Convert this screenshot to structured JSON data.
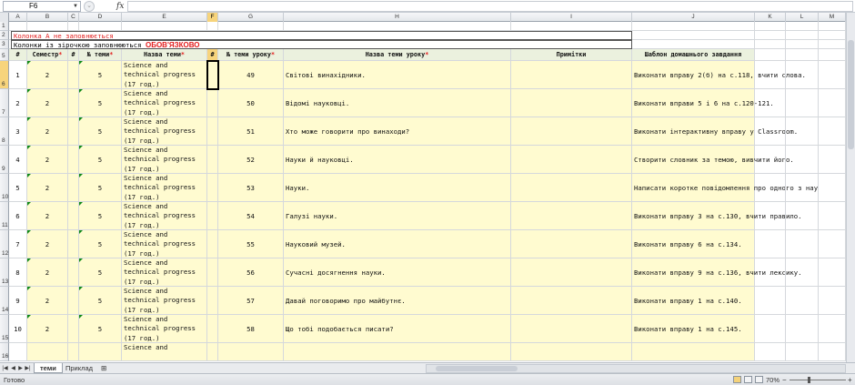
{
  "formula_bar": {
    "name_box": "F6",
    "fx_label": "fx",
    "formula_value": ""
  },
  "columns": [
    "A",
    "B",
    "C",
    "D",
    "E",
    "F",
    "G",
    "H",
    "I",
    "J",
    "K",
    "L",
    "M"
  ],
  "selected_column": "F",
  "selected_row": "6",
  "row_numbers": [
    "1",
    "2",
    "3",
    "5",
    "6",
    "7",
    "8",
    "9",
    "10",
    "11",
    "12",
    "13",
    "14",
    "15",
    "16"
  ],
  "notes": {
    "note1": "Колонка А не заповнюється",
    "note2_prefix": "Колонки із зірочкою заповнюються ",
    "note2_emph": "ОБОВ'ЯЗКОВО"
  },
  "headers": {
    "a": "#",
    "b": "Семестр",
    "c": "#",
    "d": "№ теми",
    "e": "Назва теми",
    "f": "#",
    "g": "№ теми уроку",
    "h": "Назва теми уроку",
    "i": "Примітки",
    "j": "Шаблон домашнього завдання",
    "star": "*"
  },
  "rows": [
    {
      "n": "1",
      "sem": "2",
      "topic_no": "5",
      "topic": "Science and technical progress (17 год.)",
      "lesson_no": "49",
      "lesson": "Світові винахідники.",
      "hw": "Виконати вправу 2(б) на с.118, вчити слова."
    },
    {
      "n": "2",
      "sem": "2",
      "topic_no": "5",
      "topic": "Science and technical progress (17 год.)",
      "lesson_no": "50",
      "lesson": "Відомі науковці.",
      "hw": "Виконати вправи 5 і 6 на с.120-121."
    },
    {
      "n": "3",
      "sem": "2",
      "topic_no": "5",
      "topic": "Science and technical progress (17 год.)",
      "lesson_no": "51",
      "lesson": "Хто може говорити про винаходи?",
      "hw": "Виконати інтерактивну вправу у Classroom."
    },
    {
      "n": "4",
      "sem": "2",
      "topic_no": "5",
      "topic": "Science and technical progress (17 год.)",
      "lesson_no": "52",
      "lesson": "Науки й науковці.",
      "hw": "Створити словник за темою, вивчити його."
    },
    {
      "n": "5",
      "sem": "2",
      "topic_no": "5",
      "topic": "Science and technical progress (17 год.)",
      "lesson_no": "53",
      "lesson": "Науки.",
      "hw": "Написати коротке повідомлення про одного з нау"
    },
    {
      "n": "6",
      "sem": "2",
      "topic_no": "5",
      "topic": "Science and technical progress (17 год.)",
      "lesson_no": "54",
      "lesson": "Галузі науки.",
      "hw": "Виконати вправу 3 на с.130, вчити правило."
    },
    {
      "n": "7",
      "sem": "2",
      "topic_no": "5",
      "topic": "Science and technical progress (17 год.)",
      "lesson_no": "55",
      "lesson": "Науковий музей.",
      "hw": "Виконати вправу 6 на с.134."
    },
    {
      "n": "8",
      "sem": "2",
      "topic_no": "5",
      "topic": "Science and technical progress (17 год.)",
      "lesson_no": "56",
      "lesson": "Сучасні досягнення науки.",
      "hw": "Виконати вправу 9 на с.136, вчити лексику."
    },
    {
      "n": "9",
      "sem": "2",
      "topic_no": "5",
      "topic": "Science and technical progress (17 год.)",
      "lesson_no": "57",
      "lesson": "Давай поговоримо про майбутнє.",
      "hw": "Виконати вправу 1 на с.140."
    },
    {
      "n": "10",
      "sem": "2",
      "topic_no": "5",
      "topic": "Science and technical progress (17 год.)",
      "lesson_no": "58",
      "lesson": "Що тобі подобається писати?",
      "hw": "Виконати вправу 1 на с.145."
    }
  ],
  "partial_row": {
    "topic": "Science and"
  },
  "sheet_tabs": [
    "теми",
    "Приклад"
  ],
  "active_tab": "теми",
  "status": {
    "ready": "Готово",
    "zoom": "70%",
    "minus": "−",
    "plus": "+"
  }
}
